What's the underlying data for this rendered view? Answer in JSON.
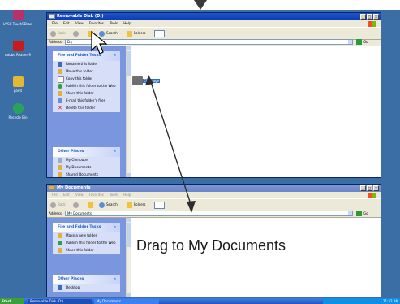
{
  "desktop": {
    "icons": [
      {
        "label": "UPSC TouchSDraw",
        "icon": "draw-app-icon"
      },
      {
        "label": "Adobe Reader 9",
        "icon": "adobe-reader-icon"
      },
      {
        "label": "paint",
        "icon": "paint-icon"
      },
      {
        "label": "Recycle Bin",
        "icon": "recycle-bin-icon"
      }
    ]
  },
  "window_top": {
    "title": "Removable Disk (D:)",
    "menu": [
      "File",
      "Edit",
      "View",
      "Favorites",
      "Tools",
      "Help"
    ],
    "toolbar": {
      "back": "Back",
      "search": "Search",
      "folders": "Folders"
    },
    "address_label": "Address",
    "address_value": "D:\\",
    "go_label": "Go",
    "tasks_header": "File and Folder Tasks",
    "tasks": [
      "Rename this folder",
      "Move this folder",
      "Copy this folder",
      "Publish this folder to the Web",
      "Share this folder",
      "E-mail this folder's files",
      "Delete this folder"
    ],
    "other_places_header": "Other Places",
    "other_places": [
      "My Computer",
      "My Documents",
      "Shared Documents"
    ],
    "folder_label": "CE Image"
  },
  "window_bottom": {
    "title": "My Documents",
    "menu": [
      "File",
      "Edit",
      "View",
      "Favorites",
      "Tools",
      "Help"
    ],
    "toolbar": {
      "back": "Back",
      "search": "Search",
      "folders": "Folders"
    },
    "address_label": "Address",
    "address_value": "My Documents",
    "go_label": "Go",
    "tasks_header": "File and Folder Tasks",
    "tasks": [
      "Make a new folder",
      "Publish this folder to the Web",
      "Share this folder"
    ],
    "other_places_header": "Other Places",
    "other_places": [
      "Desktop"
    ]
  },
  "annotation": {
    "text": "Drag to My Documents"
  },
  "taskbar": {
    "start": "Start",
    "buttons": [
      "Removable Disk (D:)",
      "My Documents"
    ],
    "clock": "11:52 AM"
  },
  "colors": {
    "wallpaper": "#3a6ea5",
    "titlebar_active": "#0a3bb4",
    "titlebar_inactive": "#7d96d4",
    "taskpane": "#7a96df",
    "selection": "#316ac5"
  }
}
